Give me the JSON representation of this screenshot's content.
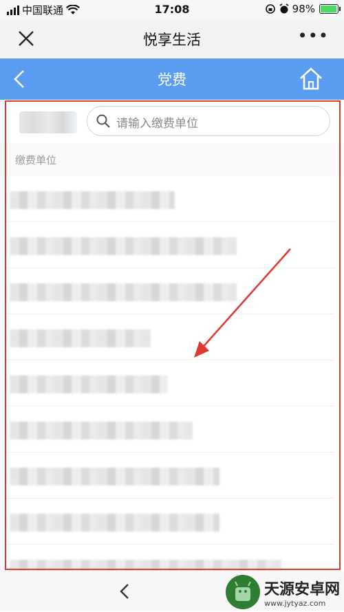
{
  "status_bar": {
    "carrier": "中国联通",
    "time": "17:08",
    "battery": "98%",
    "battery_level": 0.98
  },
  "app_bar": {
    "title": "悦享生活",
    "more_label": "•••"
  },
  "nav_bar": {
    "title": "党费",
    "color": "#5a9cf0"
  },
  "search": {
    "placeholder": "请输入缴费单位"
  },
  "section": {
    "label": "缴费单位"
  },
  "list_items": [
    {
      "name": "redacted-unit-1"
    },
    {
      "name": "redacted-unit-2"
    },
    {
      "name": "redacted-unit-3"
    },
    {
      "name": "redacted-unit-4"
    },
    {
      "name": "redacted-unit-5"
    },
    {
      "name": "redacted-unit-6"
    },
    {
      "name": "redacted-unit-7"
    },
    {
      "name": "redacted-unit-8"
    },
    {
      "name": "redacted-unit-9"
    }
  ],
  "watermark": {
    "title": "天源安卓网",
    "url": "www.jytyaz.com"
  },
  "icons": {
    "close": "close-icon",
    "back": "back-arrow-icon",
    "home": "home-icon",
    "search": "search-icon",
    "wifi": "wifi-icon",
    "alarm": "alarm-icon"
  },
  "colors": {
    "accent_blue": "#5a9cf0",
    "highlight_red": "#e0392f"
  }
}
